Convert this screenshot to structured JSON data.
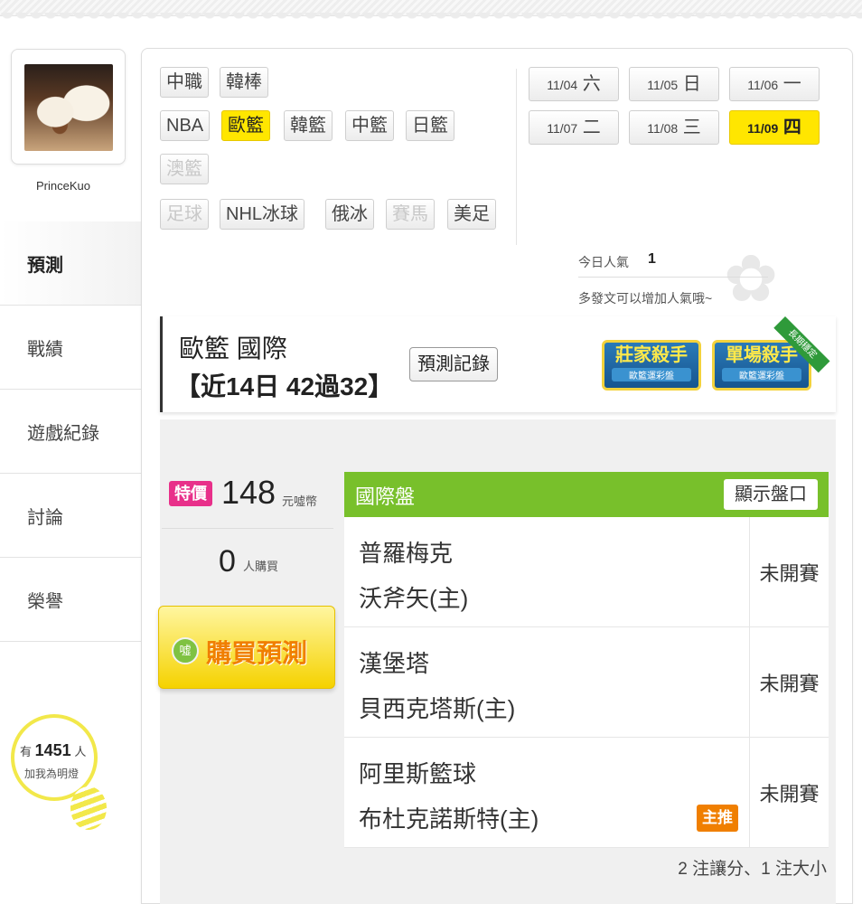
{
  "profile": {
    "username": "PrinceKuo"
  },
  "nav": {
    "items": [
      {
        "label": "預測"
      },
      {
        "label": "戰績"
      },
      {
        "label": "遊戲紀錄"
      },
      {
        "label": "討論"
      },
      {
        "label": "榮譽"
      }
    ]
  },
  "fans": {
    "prefix": "有",
    "count": "1451",
    "suffix": "人",
    "caption": "加我為明燈"
  },
  "sports": {
    "items": [
      {
        "label": "中職",
        "state": "normal"
      },
      {
        "label": "韓棒",
        "state": "normal"
      },
      {
        "label": "NBA",
        "state": "normal"
      },
      {
        "label": "歐籃",
        "state": "active"
      },
      {
        "label": "韓籃",
        "state": "normal"
      },
      {
        "label": "中籃",
        "state": "normal"
      },
      {
        "label": "日籃",
        "state": "normal"
      },
      {
        "label": "澳籃",
        "state": "disabled"
      },
      {
        "label": "足球",
        "state": "disabled"
      },
      {
        "label": "NHL冰球",
        "state": "normal"
      },
      {
        "label": "俄冰",
        "state": "normal"
      },
      {
        "label": "賽馬",
        "state": "disabled"
      },
      {
        "label": "美足",
        "state": "normal"
      }
    ]
  },
  "dates": {
    "items": [
      {
        "md": "11/04",
        "dow": "六",
        "active": false
      },
      {
        "md": "11/05",
        "dow": "日",
        "active": false
      },
      {
        "md": "11/06",
        "dow": "一",
        "active": false
      },
      {
        "md": "11/07",
        "dow": "二",
        "active": false
      },
      {
        "md": "11/08",
        "dow": "三",
        "active": false
      },
      {
        "md": "11/09",
        "dow": "四",
        "active": true
      }
    ]
  },
  "popularity": {
    "label": "今日人氣",
    "value": "1",
    "tip": "多發文可以增加人氣哦~"
  },
  "league": {
    "title": "歐籃 國際",
    "record": "【近14日 42過32】",
    "history_button": "預測記錄",
    "badges": [
      {
        "title": "莊家殺手",
        "subtitle": "歐籃運彩盤"
      },
      {
        "title": "單場殺手",
        "subtitle": "歐籃運彩盤"
      }
    ],
    "ribbon": "長期穩定"
  },
  "purchase": {
    "tag": "特價",
    "price": "148",
    "price_unit": "元噓幣",
    "buyers": "0",
    "buyers_unit": "人購買",
    "coin": "噓",
    "button": "購買預測"
  },
  "table": {
    "title": "國際盤",
    "show_button": "顯示盤口",
    "games": [
      {
        "away": "普羅梅克",
        "home": "沃斧矢(主)",
        "status": "未開賽",
        "tag": ""
      },
      {
        "away": "漢堡塔",
        "home": "貝西克塔斯(主)",
        "status": "未開賽",
        "tag": ""
      },
      {
        "away": "阿里斯籃球",
        "home": "布杜克諾斯特(主)",
        "status": "未開賽",
        "tag": "主推"
      }
    ],
    "summary": "2 注讓分、1 注大小"
  },
  "colors": {
    "highlight": "#ffe600",
    "table_header": "#78c02b",
    "price_tag": "#e8308a",
    "pick_tag": "#f07f00"
  }
}
